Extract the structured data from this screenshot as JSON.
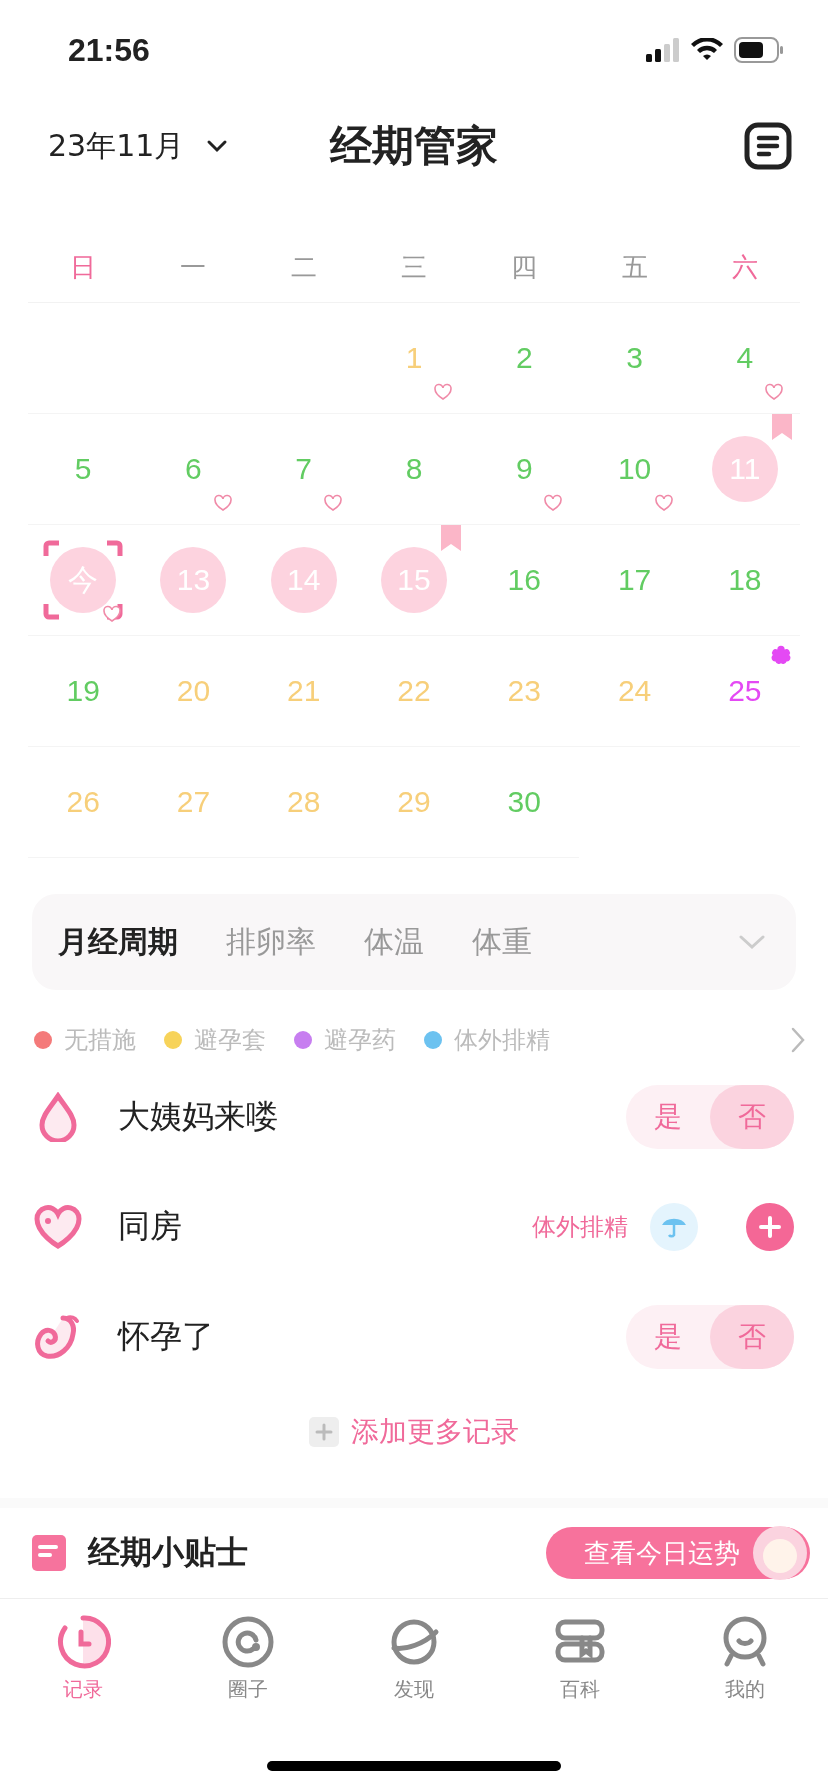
{
  "status_bar": {
    "time": "21:56"
  },
  "header": {
    "month": "23年11月",
    "title": "经期管家"
  },
  "weekdays": [
    {
      "label": "日",
      "weekend": true
    },
    {
      "label": "一",
      "weekend": false
    },
    {
      "label": "二",
      "weekend": false
    },
    {
      "label": "三",
      "weekend": false
    },
    {
      "label": "四",
      "weekend": false
    },
    {
      "label": "五",
      "weekend": false
    },
    {
      "label": "六",
      "weekend": true
    }
  ],
  "days": [
    {
      "kind": "blank"
    },
    {
      "kind": "blank"
    },
    {
      "kind": "blank"
    },
    {
      "kind": "fertile",
      "label": "1",
      "heart": true,
      "bookmark": false,
      "flower": false
    },
    {
      "kind": "safe",
      "label": "2",
      "heart": false,
      "bookmark": false,
      "flower": false
    },
    {
      "kind": "safe",
      "label": "3",
      "heart": false,
      "bookmark": false,
      "flower": false
    },
    {
      "kind": "safe",
      "label": "4",
      "heart": true,
      "bookmark": false,
      "flower": false
    },
    {
      "kind": "safe",
      "label": "5",
      "heart": false,
      "bookmark": false,
      "flower": false
    },
    {
      "kind": "safe",
      "label": "6",
      "heart": true,
      "bookmark": false,
      "flower": false
    },
    {
      "kind": "safe",
      "label": "7",
      "heart": true,
      "bookmark": false,
      "flower": false
    },
    {
      "kind": "safe",
      "label": "8",
      "heart": false,
      "bookmark": false,
      "flower": false
    },
    {
      "kind": "safe",
      "label": "9",
      "heart": true,
      "bookmark": false,
      "flower": false
    },
    {
      "kind": "safe",
      "label": "10",
      "heart": true,
      "bookmark": false,
      "flower": false
    },
    {
      "kind": "period",
      "label": "11",
      "heart": false,
      "bookmark": true,
      "flower": false
    },
    {
      "kind": "today",
      "label": "今",
      "heart": true,
      "bookmark": false,
      "flower": false
    },
    {
      "kind": "period",
      "label": "13",
      "heart": false,
      "bookmark": false,
      "flower": false
    },
    {
      "kind": "period",
      "label": "14",
      "heart": false,
      "bookmark": false,
      "flower": false
    },
    {
      "kind": "period",
      "label": "15",
      "heart": false,
      "bookmark": true,
      "flower": false
    },
    {
      "kind": "safe",
      "label": "16",
      "heart": false,
      "bookmark": false,
      "flower": false
    },
    {
      "kind": "safe",
      "label": "17",
      "heart": false,
      "bookmark": false,
      "flower": false
    },
    {
      "kind": "safe",
      "label": "18",
      "heart": false,
      "bookmark": false,
      "flower": false
    },
    {
      "kind": "safe",
      "label": "19",
      "heart": false,
      "bookmark": false,
      "flower": false
    },
    {
      "kind": "fertile",
      "label": "20",
      "heart": false,
      "bookmark": false,
      "flower": false
    },
    {
      "kind": "fertile",
      "label": "21",
      "heart": false,
      "bookmark": false,
      "flower": false
    },
    {
      "kind": "fertile",
      "label": "22",
      "heart": false,
      "bookmark": false,
      "flower": false
    },
    {
      "kind": "fertile",
      "label": "23",
      "heart": false,
      "bookmark": false,
      "flower": false
    },
    {
      "kind": "fertile",
      "label": "24",
      "heart": false,
      "bookmark": false,
      "flower": false
    },
    {
      "kind": "ovulation",
      "label": "25",
      "heart": false,
      "bookmark": false,
      "flower": true
    },
    {
      "kind": "fertile",
      "label": "26",
      "heart": false,
      "bookmark": false,
      "flower": false
    },
    {
      "kind": "fertile",
      "label": "27",
      "heart": false,
      "bookmark": false,
      "flower": false
    },
    {
      "kind": "fertile",
      "label": "28",
      "heart": false,
      "bookmark": false,
      "flower": false
    },
    {
      "kind": "fertile",
      "label": "29",
      "heart": false,
      "bookmark": false,
      "flower": false
    },
    {
      "kind": "safe",
      "label": "30",
      "heart": false,
      "bookmark": false,
      "flower": false
    }
  ],
  "chart_tabs": [
    {
      "label": "月经周期",
      "selected": true
    },
    {
      "label": "排卵率",
      "selected": false
    },
    {
      "label": "体温",
      "selected": false
    },
    {
      "label": "体重",
      "selected": false
    }
  ],
  "legend": [
    {
      "label": "无措施",
      "color": "#f47a7a"
    },
    {
      "label": "避孕套",
      "color": "#f7d35a"
    },
    {
      "label": "避孕药",
      "color": "#c77ef0"
    },
    {
      "label": "体外排精",
      "color": "#6cc2f0"
    }
  ],
  "records": [
    {
      "kind": "toggle",
      "label": "大姨妈来喽",
      "options": [
        {
          "label": "是",
          "selected": false
        },
        {
          "label": "否",
          "selected": true
        }
      ]
    },
    {
      "kind": "tags",
      "label": "同房",
      "tag": "体外排精"
    },
    {
      "kind": "toggle",
      "label": "怀孕了",
      "options": [
        {
          "label": "是",
          "selected": false
        },
        {
          "label": "否",
          "selected": true
        }
      ]
    }
  ],
  "add_more": "添加更多记录",
  "tips": {
    "title": "经期小贴士",
    "button": "查看今日运势"
  },
  "tab_bar": [
    {
      "label": "记录",
      "selected": true
    },
    {
      "label": "圈子",
      "selected": false
    },
    {
      "label": "发现",
      "selected": false
    },
    {
      "label": "百科",
      "selected": false
    },
    {
      "label": "我的",
      "selected": false
    }
  ]
}
